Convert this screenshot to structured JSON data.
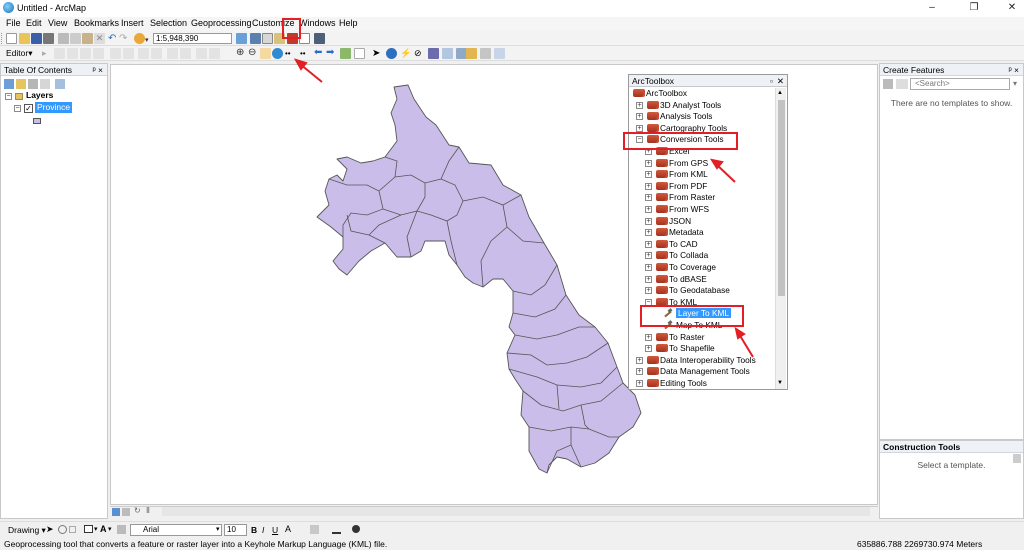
{
  "app": {
    "title": "Untitled - ArcMap"
  },
  "window_controls": {
    "minimize": "–",
    "maximize": "❐",
    "close": "✕"
  },
  "menu": [
    "File",
    "Edit",
    "View",
    "Bookmarks",
    "Insert",
    "Selection",
    "Geoprocessing",
    "Customize",
    "Windows",
    "Help"
  ],
  "toolbar": {
    "scale": "1:5,948,390",
    "editor_label": "Editor▾"
  },
  "toc": {
    "title": "Table Of Contents",
    "layers_label": "Layers",
    "layer_name": "Province",
    "pin": "ᵖ ×"
  },
  "arctoolbox": {
    "title": "ArcToolbox",
    "root": "ArcToolbox",
    "items": [
      {
        "label": "3D Analyst Tools",
        "level": 1,
        "exp": "+"
      },
      {
        "label": "Analysis Tools",
        "level": 1,
        "exp": "+"
      },
      {
        "label": "Cartography Tools",
        "level": 1,
        "exp": "+"
      },
      {
        "label": "Conversion Tools",
        "level": 1,
        "exp": "−"
      },
      {
        "label": "Excel",
        "level": 2,
        "exp": "+"
      },
      {
        "label": "From GPS",
        "level": 2,
        "exp": "+"
      },
      {
        "label": "From KML",
        "level": 2,
        "exp": "+"
      },
      {
        "label": "From PDF",
        "level": 2,
        "exp": "+"
      },
      {
        "label": "From Raster",
        "level": 2,
        "exp": "+"
      },
      {
        "label": "From WFS",
        "level": 2,
        "exp": "+"
      },
      {
        "label": "JSON",
        "level": 2,
        "exp": "+"
      },
      {
        "label": "Metadata",
        "level": 2,
        "exp": "+"
      },
      {
        "label": "To CAD",
        "level": 2,
        "exp": "+"
      },
      {
        "label": "To Collada",
        "level": 2,
        "exp": "+"
      },
      {
        "label": "To Coverage",
        "level": 2,
        "exp": "+"
      },
      {
        "label": "To dBASE",
        "level": 2,
        "exp": "+"
      },
      {
        "label": "To Geodatabase",
        "level": 2,
        "exp": "+"
      },
      {
        "label": "To KML",
        "level": 2,
        "exp": "−"
      },
      {
        "label": "Layer To KML",
        "level": 3,
        "exp": "",
        "tool": true,
        "selected": true
      },
      {
        "label": "Map To KML",
        "level": 3,
        "exp": "",
        "tool": true
      },
      {
        "label": "To Raster",
        "level": 2,
        "exp": "+"
      },
      {
        "label": "To Shapefile",
        "level": 2,
        "exp": "+"
      },
      {
        "label": "Data Interoperability Tools",
        "level": 1,
        "exp": "+"
      },
      {
        "label": "Data Management Tools",
        "level": 1,
        "exp": "+"
      },
      {
        "label": "Editing Tools",
        "level": 1,
        "exp": "+"
      }
    ]
  },
  "create_features": {
    "title": "Create Features",
    "search_placeholder": "<Search>",
    "empty_msg": "There are no templates to show.",
    "construction_title": "Construction Tools",
    "construction_msg": "Select a template."
  },
  "draw_toolbar": {
    "drawing": "Drawing ▾",
    "font": "Arial",
    "size": "10",
    "bold": "B",
    "italic": "I",
    "underline": "U",
    "font_a": "A"
  },
  "status": {
    "message": "Geoprocessing tool that converts a feature or raster layer into a Keyhole Markup Language (KML) file.",
    "coords": "635886.788  2269730.974 Meters"
  },
  "colors": {
    "accent": "#e31e24",
    "polygon_fill": "#cbbde9",
    "polygon_stroke": "#555555",
    "selection": "#3399ff"
  }
}
